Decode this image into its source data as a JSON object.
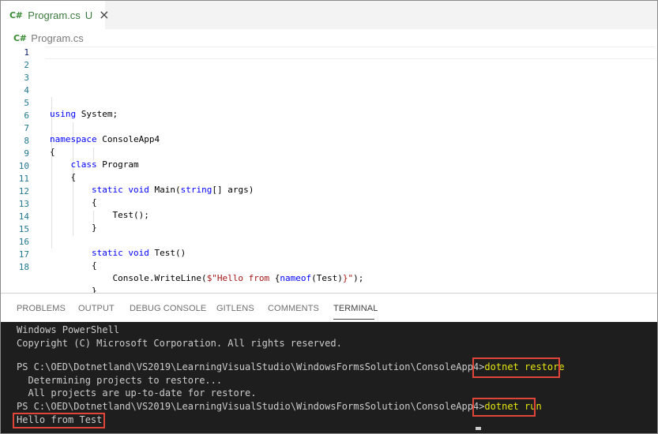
{
  "tab": {
    "icon": "C#",
    "title": "Program.cs",
    "badge": "U",
    "close": "×"
  },
  "breadcrumb": {
    "icon": "C#",
    "file": "Program.cs"
  },
  "editor": {
    "line_numbers": [
      "1",
      "2",
      "3",
      "4",
      "5",
      "6",
      "7",
      "8",
      "9",
      "10",
      "11",
      "12",
      "13",
      "14",
      "15",
      "16",
      "17",
      "18"
    ],
    "lines": [
      [
        {
          "t": "using",
          "c": "kw"
        },
        {
          "t": " System;"
        }
      ],
      [],
      [
        {
          "t": "namespace",
          "c": "kw"
        },
        {
          "t": " ConsoleApp4"
        }
      ],
      [
        {
          "t": "{"
        }
      ],
      [
        {
          "t": "    "
        },
        {
          "t": "class",
          "c": "kw"
        },
        {
          "t": " Program"
        }
      ],
      [
        {
          "t": "    {"
        }
      ],
      [
        {
          "t": "        "
        },
        {
          "t": "static",
          "c": "kw"
        },
        {
          "t": " "
        },
        {
          "t": "void",
          "c": "kw"
        },
        {
          "t": " Main("
        },
        {
          "t": "string",
          "c": "kw"
        },
        {
          "t": "[] args)"
        }
      ],
      [
        {
          "t": "        {"
        }
      ],
      [
        {
          "t": "            Test();"
        }
      ],
      [
        {
          "t": "        }"
        }
      ],
      [],
      [
        {
          "t": "        "
        },
        {
          "t": "static",
          "c": "kw"
        },
        {
          "t": " "
        },
        {
          "t": "void",
          "c": "kw"
        },
        {
          "t": " Test()"
        }
      ],
      [
        {
          "t": "        {"
        }
      ],
      [
        {
          "t": "            Console.WriteLine("
        },
        {
          "t": "$\"Hello from ",
          "c": "str"
        },
        {
          "t": "{"
        },
        {
          "t": "nameof",
          "c": "kw"
        },
        {
          "t": "(Test)"
        },
        {
          "t": "}",
          "c": "str"
        },
        {
          "t": "\"",
          "c": "str"
        },
        {
          "t": ");"
        }
      ],
      [
        {
          "t": "        }"
        }
      ],
      [
        {
          "t": "    }"
        }
      ],
      [
        {
          "t": "}"
        }
      ],
      []
    ]
  },
  "panel": {
    "tabs": [
      "PROBLEMS",
      "OUTPUT",
      "DEBUG CONSOLE",
      "GITLENS",
      "COMMENTS",
      "TERMINAL"
    ],
    "active_tab": "TERMINAL"
  },
  "terminal": {
    "header1": "Windows PowerShell",
    "header2": "Copyright (C) Microsoft Corporation. All rights reserved.",
    "prompt": "PS C:\\OED\\Dotnetland\\VS2019\\LearningVisualStudio\\WindowsFormsSolution\\ConsoleApp4>",
    "cmd1": "dotnet restore",
    "out1": "  Determining projects to restore...",
    "out2": "  All projects are up-to-date for restore.",
    "cmd2": "dotnet run",
    "result": "Hello from Test"
  },
  "colors": {
    "keyword": "#0000ff",
    "string": "#a31515",
    "terminal_bg": "#1e1e1e",
    "command": "#e5e510",
    "highlight_box": "#e0453a",
    "csharp_icon": "#388a34"
  }
}
